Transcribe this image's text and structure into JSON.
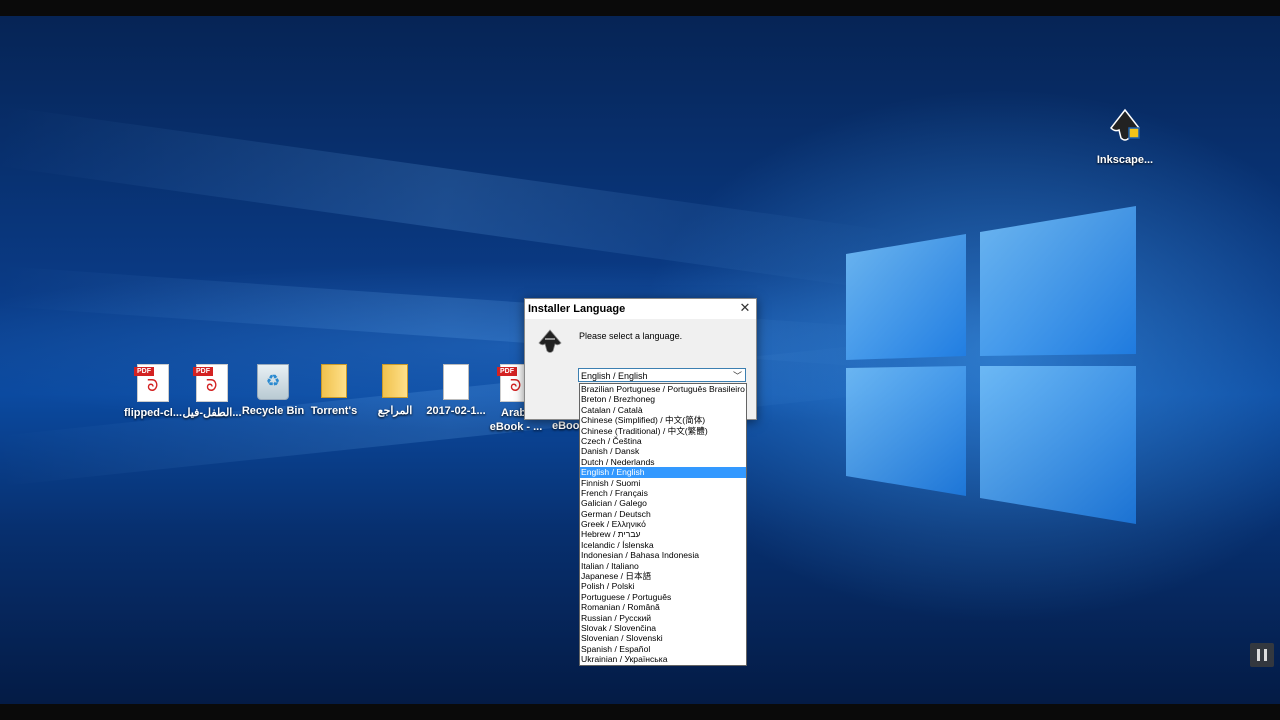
{
  "desktop": {
    "icons": [
      {
        "label": "flipped-cl...",
        "type": "pdf"
      },
      {
        "label": "الطفل-فيل...",
        "type": "pdf"
      },
      {
        "label": "Recycle Bin",
        "type": "bin"
      },
      {
        "label": "Torrent's",
        "type": "folder"
      },
      {
        "label": "المراجع",
        "type": "folder"
      },
      {
        "label": "2017-02-1...",
        "type": "file"
      },
      {
        "label_line1": "Arab",
        "label_line2": "eBook - ...",
        "type": "pdf"
      },
      {
        "label": "eBoo",
        "type": "pdf"
      }
    ],
    "inkscape_icon": {
      "label": "Inkscape..."
    }
  },
  "dialog": {
    "title": "Installer Language",
    "close_glyph": "✕",
    "message": "Please select a language.",
    "combo_value": "English / English",
    "options": [
      "Brazilian Portuguese / Português Brasileiro",
      "Breton / Brezhoneg",
      "Catalan / Català",
      "Chinese (Simplified) / 中文(简体)",
      "Chinese (Traditional) / 中文(繁體)",
      "Czech / Čeština",
      "Danish / Dansk",
      "Dutch / Nederlands",
      "English / English",
      "Finnish / Suomi",
      "French / Français",
      "Galician / Galego",
      "German / Deutsch",
      "Greek / Ελληνικό",
      "Hebrew / עברית",
      "Icelandic / Íslenska",
      "Indonesian / Bahasa Indonesia",
      "Italian / Italiano",
      "Japanese / 日本語",
      "Polish / Polski",
      "Portuguese / Português",
      "Romanian / Română",
      "Russian / Русский",
      "Slovak / Slovenčina",
      "Slovenian / Slovenski",
      "Spanish / Español",
      "Ukrainian / Українська"
    ],
    "selected_option": "English / English"
  },
  "colors": {
    "selection": "#3399ff",
    "desktop_blue": "#0b4aa0"
  }
}
